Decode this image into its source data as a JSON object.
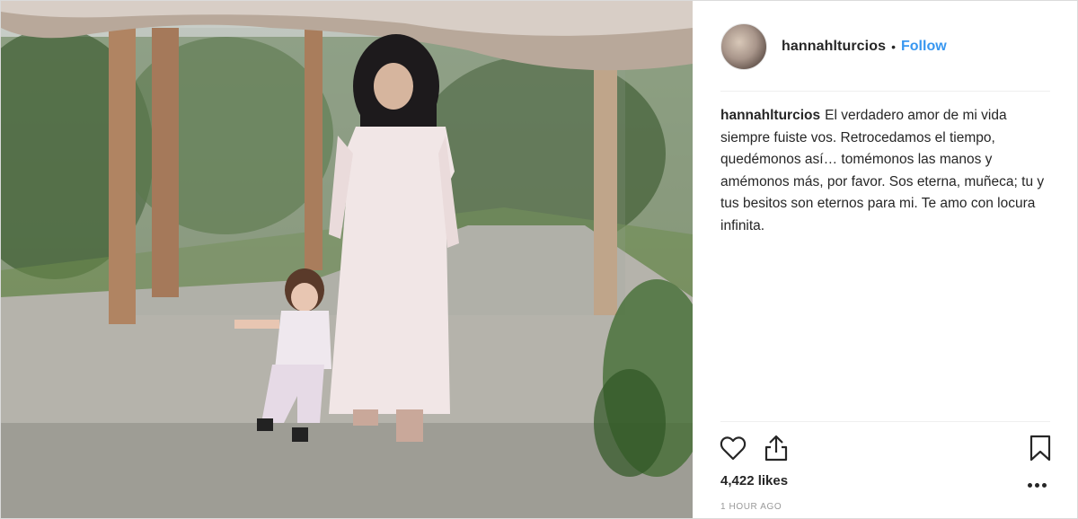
{
  "post": {
    "username": "hannahlturcios",
    "separator": "•",
    "follow_label": "Follow",
    "caption_user": "hannahlturcios",
    "caption_text": "El verdadero amor de mi vida siempre fuiste vos. Retrocedamos el tiempo, quedémonos así… tomémonos las manos y amémonos más, por favor. Sos eterna, muñeca; tu y tus besitos son eternos para mi. Te amo con locura infinita.",
    "likes": "4,422 likes",
    "timestamp": "1 HOUR AGO"
  },
  "icons": {
    "like": "heart-outline-icon",
    "share": "share-upload-icon",
    "save": "bookmark-icon",
    "more": "more-options-icon"
  },
  "colors": {
    "follow": "#3897f0",
    "text": "#262626",
    "muted": "#999999"
  }
}
